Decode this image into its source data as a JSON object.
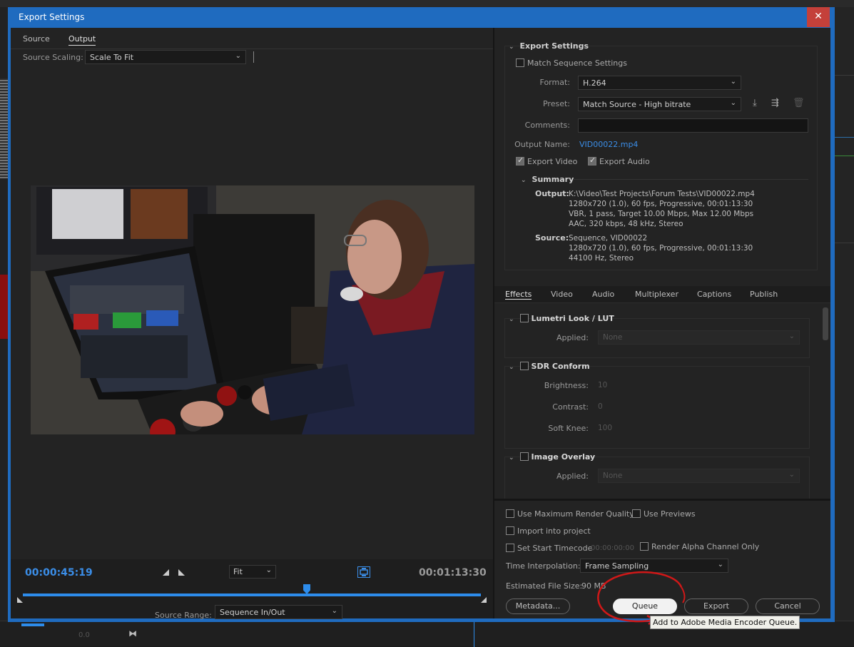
{
  "background": {
    "timeline_value": "0.0"
  },
  "dialog": {
    "title": "Export Settings",
    "close_label": "✕"
  },
  "left": {
    "tabs": [
      {
        "label": "Source"
      },
      {
        "label": "Output"
      }
    ],
    "source_scaling_label": "Source Scaling:",
    "source_scaling_value": "Scale To Fit",
    "current_timecode": "00:00:45:19",
    "duration_timecode": "00:01:13:30",
    "zoom_value": "Fit",
    "source_range_label": "Source Range:",
    "source_range_value": "Sequence In/Out",
    "playhead_fraction": 0.62
  },
  "export_settings": {
    "heading": "Export Settings",
    "match_sequence_label": "Match Sequence Settings",
    "match_sequence_checked": false,
    "format_label": "Format:",
    "format_value": "H.264",
    "preset_label": "Preset:",
    "preset_value": "Match Source - High bitrate",
    "comments_label": "Comments:",
    "comments_value": "",
    "output_name_label": "Output Name:",
    "output_name_value": "VID00022.mp4",
    "export_video_label": "Export Video",
    "export_audio_label": "Export Audio",
    "summary": {
      "heading": "Summary",
      "output_label": "Output:",
      "output_lines": [
        "K:\\Video\\Test Projects\\Forum Tests\\VID00022.mp4",
        "1280x720 (1.0), 60 fps, Progressive, 00:01:13:30",
        "VBR, 1 pass, Target 10.00 Mbps, Max 12.00 Mbps",
        "AAC, 320 kbps, 48 kHz, Stereo"
      ],
      "source_label": "Source:",
      "source_lines": [
        "Sequence, VID00022",
        "1280x720 (1.0), 60 fps, Progressive, 00:01:13:30",
        "44100 Hz, Stereo"
      ]
    }
  },
  "effects": {
    "tabs": [
      {
        "label": "Effects"
      },
      {
        "label": "Video"
      },
      {
        "label": "Audio"
      },
      {
        "label": "Multiplexer"
      },
      {
        "label": "Captions"
      },
      {
        "label": "Publish"
      }
    ],
    "lumetri": {
      "title": "Lumetri Look / LUT",
      "applied_label": "Applied:",
      "applied_value": "None"
    },
    "sdr": {
      "title": "SDR Conform",
      "brightness_label": "Brightness:",
      "brightness_value": "10",
      "contrast_label": "Contrast:",
      "contrast_value": "0",
      "knee_label": "Soft Knee:",
      "knee_value": "100"
    },
    "overlay": {
      "title": "Image Overlay",
      "applied_label": "Applied:",
      "applied_value": "None"
    }
  },
  "bottom": {
    "max_quality_label": "Use Maximum Render Quality",
    "use_previews_label": "Use Previews",
    "import_project_label": "Import into project",
    "set_start_tc_label": "Set Start Timecode",
    "start_tc_value": "00:00:00:00",
    "render_alpha_label": "Render Alpha Channel Only",
    "time_interp_label": "Time Interpolation:",
    "time_interp_value": "Frame Sampling",
    "est_size_label": "Estimated File Size:",
    "est_size_value": "90 MB",
    "metadata_btn": "Metadata...",
    "queue_btn": "Queue",
    "export_btn": "Export",
    "cancel_btn": "Cancel",
    "tooltip": "Add to Adobe Media Encoder Queue."
  },
  "colors": {
    "accent": "#2d8ceb",
    "dialog_frame": "#1f6bbf",
    "close": "#c4403a",
    "annotation": "#d01818"
  }
}
